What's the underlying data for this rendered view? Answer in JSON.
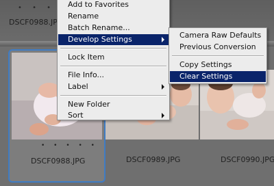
{
  "top_row": {
    "rating_dots": "• • • •",
    "filename": "DSCF0988.JPG"
  },
  "thumbnails": [
    {
      "filename": "DSCF0988.JPG",
      "rating_dots": "• • • • •",
      "selected": true
    },
    {
      "filename": "DSCF0989.JPG",
      "selected": false
    },
    {
      "filename": "DSCF0990.JPG",
      "selected": false
    }
  ],
  "context_menu": {
    "items": [
      {
        "label": "Add to Favorites"
      },
      {
        "label": "Rename"
      },
      {
        "label": "Batch Rename..."
      },
      {
        "label": "Develop Settings",
        "submenu": true,
        "active": true
      },
      {
        "label": "Lock Item"
      },
      {
        "label": "File Info..."
      },
      {
        "label": "Label",
        "submenu": true
      },
      {
        "label": "New Folder"
      },
      {
        "label": "Sort",
        "submenu": true
      }
    ]
  },
  "develop_submenu": {
    "items": [
      {
        "label": "Camera Raw Defaults"
      },
      {
        "label": "Previous Conversion"
      },
      {
        "label": "Copy Settings"
      },
      {
        "label": "Clear Settings",
        "active": true
      }
    ]
  },
  "colors": {
    "menu_highlight": "#0a246a",
    "selection_border": "#3f7cc4",
    "menu_background": "#ececec",
    "panel_background": "#6f6f6f"
  }
}
